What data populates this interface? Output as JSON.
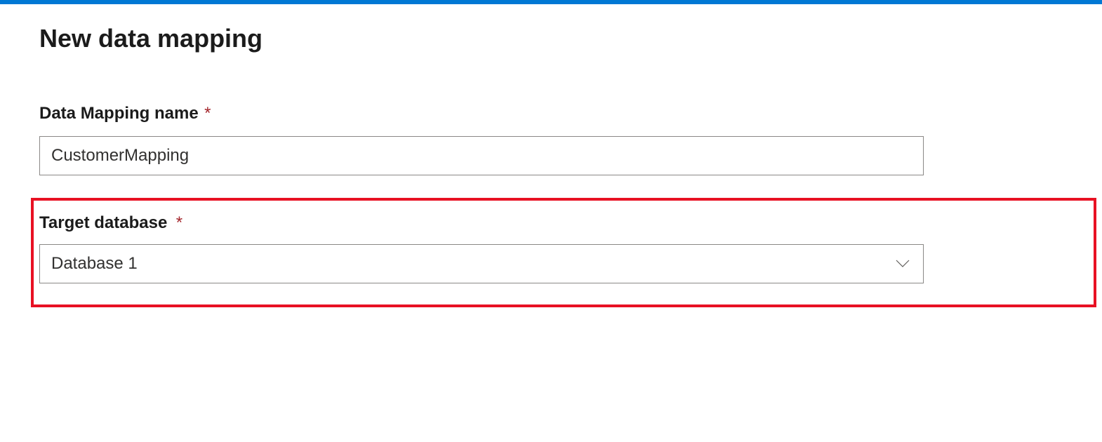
{
  "page": {
    "title": "New data mapping"
  },
  "fields": {
    "name": {
      "label": "Data Mapping name",
      "required_marker": "*",
      "value": "CustomerMapping"
    },
    "target_database": {
      "label": "Target database",
      "required_marker": "*",
      "selected": "Database 1"
    }
  },
  "colors": {
    "accent_bar": "#0078d4",
    "highlight_border": "#e81123",
    "required": "#a4262c"
  }
}
